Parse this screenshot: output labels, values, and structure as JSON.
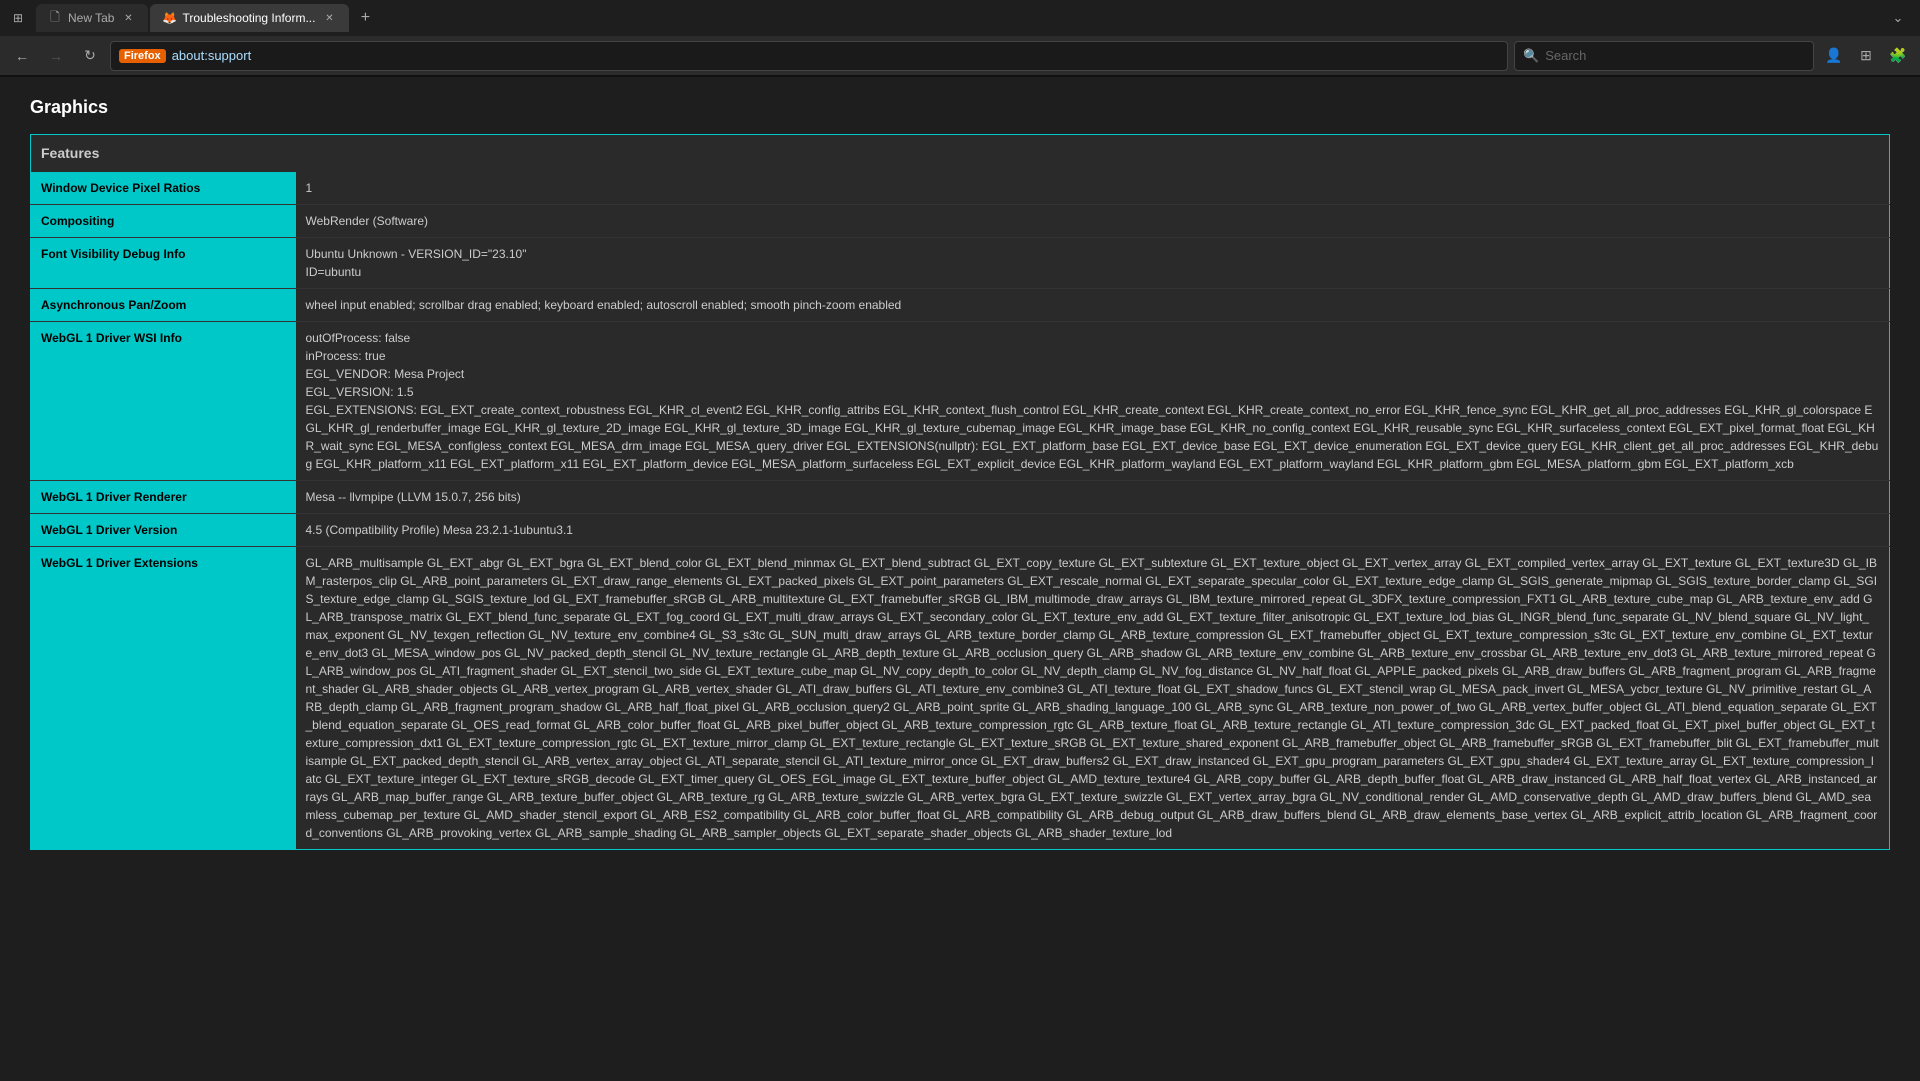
{
  "browser": {
    "window_icon": "⊞",
    "tabs": [
      {
        "id": "new-tab",
        "label": "New Tab",
        "active": false,
        "icon": "tab"
      },
      {
        "id": "troubleshooting",
        "label": "Troubleshooting Inform...",
        "active": true,
        "icon": "firefox"
      }
    ],
    "new_tab_label": "+",
    "tab_overflow_label": "⌄",
    "nav": {
      "back_disabled": false,
      "forward_disabled": true,
      "reload": "↻",
      "address": "about:support",
      "firefox_label": "Firefox",
      "search_placeholder": "Search"
    }
  },
  "page": {
    "section_title": "Graphics",
    "table": {
      "header": "Features",
      "rows": [
        {
          "key": "Window Device Pixel Ratios",
          "value": "1"
        },
        {
          "key": "Compositing",
          "value": "WebRender (Software)"
        },
        {
          "key": "Font Visibility Debug Info",
          "value": "Ubuntu Unknown - VERSION_ID=\"23.10\"\nID=ubuntu"
        },
        {
          "key": "Asynchronous Pan/Zoom",
          "value": "wheel input enabled; scrollbar drag enabled; keyboard enabled; autoscroll enabled; smooth pinch-zoom enabled"
        },
        {
          "key": "WebGL 1 Driver WSI Info",
          "value": "outOfProcess: false\ninProcess: true\nEGL_VENDOR: Mesa Project\nEGL_VERSION: 1.5\nEGL_EXTENSIONS: EGL_EXT_create_context_robustness EGL_KHR_cl_event2 EGL_KHR_config_attribs EGL_KHR_context_flush_control EGL_KHR_create_context EGL_KHR_create_context_no_error EGL_KHR_fence_sync EGL_KHR_get_all_proc_addresses EGL_KHR_gl_colorspace EGL_KHR_gl_renderbuffer_image EGL_KHR_gl_texture_2D_image EGL_KHR_gl_texture_3D_image EGL_KHR_gl_texture_cubemap_image EGL_KHR_image_base EGL_KHR_no_config_context EGL_KHR_reusable_sync EGL_KHR_surfaceless_context EGL_EXT_pixel_format_float EGL_KHR_wait_sync EGL_MESA_configless_context EGL_MESA_drm_image EGL_MESA_query_driver EGL_EXTENSIONS(nullptr): EGL_EXT_platform_base EGL_EXT_device_base EGL_EXT_device_enumeration EGL_EXT_device_query EGL_KHR_client_get_all_proc_addresses EGL_KHR_debug EGL_KHR_platform_x11 EGL_EXT_platform_x11 EGL_EXT_platform_device EGL_MESA_platform_surfaceless EGL_EXT_explicit_device EGL_KHR_platform_wayland EGL_EXT_platform_wayland EGL_KHR_platform_gbm EGL_MESA_platform_gbm EGL_EXT_platform_xcb"
        },
        {
          "key": "WebGL 1 Driver Renderer",
          "value": "Mesa -- llvmpipe (LLVM 15.0.7, 256 bits)"
        },
        {
          "key": "WebGL 1 Driver Version",
          "value": "4.5 (Compatibility Profile) Mesa 23.2.1-1ubuntu3.1"
        },
        {
          "key": "WebGL 1 Driver Extensions",
          "value": "GL_ARB_multisample GL_EXT_abgr GL_EXT_bgra GL_EXT_blend_color GL_EXT_blend_minmax GL_EXT_blend_subtract GL_EXT_copy_texture GL_EXT_subtexture GL_EXT_texture_object GL_EXT_vertex_array GL_EXT_compiled_vertex_array GL_EXT_texture GL_EXT_texture3D GL_IBM_rasterpos_clip GL_ARB_point_parameters GL_EXT_draw_range_elements GL_EXT_packed_pixels GL_EXT_point_parameters GL_EXT_rescale_normal GL_EXT_separate_specular_color GL_EXT_texture_edge_clamp GL_SGIS_generate_mipmap GL_SGIS_texture_border_clamp GL_SGIS_texture_edge_clamp GL_SGIS_texture_lod GL_EXT_framebuffer_sRGB GL_ARB_multitexture GL_EXT_framebuffer_sRGB GL_IBM_multimode_draw_arrays GL_IBM_texture_mirrored_repeat GL_3DFX_texture_compression_FXT1 GL_ARB_texture_cube_map GL_ARB_texture_env_add GL_ARB_transpose_matrix GL_EXT_blend_func_separate GL_EXT_fog_coord GL_EXT_multi_draw_arrays GL_EXT_secondary_color GL_EXT_texture_env_add GL_EXT_texture_filter_anisotropic GL_EXT_texture_lod_bias GL_INGR_blend_func_separate GL_NV_blend_square GL_NV_light_max_exponent GL_NV_texgen_reflection GL_NV_texture_env_combine4 GL_S3_s3tc GL_SUN_multi_draw_arrays GL_ARB_texture_border_clamp GL_ARB_texture_compression GL_EXT_framebuffer_object GL_EXT_texture_compression_s3tc GL_EXT_texture_env_combine GL_EXT_texture_env_dot3 GL_MESA_window_pos GL_NV_packed_depth_stencil GL_NV_texture_rectangle GL_ARB_depth_texture GL_ARB_occlusion_query GL_ARB_shadow GL_ARB_texture_env_combine GL_ARB_texture_env_crossbar GL_ARB_texture_env_dot3 GL_ARB_texture_mirrored_repeat GL_ARB_window_pos GL_ATI_fragment_shader GL_EXT_stencil_two_side GL_EXT_texture_cube_map GL_NV_copy_depth_to_color GL_NV_depth_clamp GL_NV_fog_distance GL_NV_half_float GL_APPLE_packed_pixels GL_ARB_draw_buffers GL_ARB_fragment_program GL_ARB_fragment_shader GL_ARB_shader_objects GL_ARB_vertex_program GL_ARB_vertex_shader GL_ATI_draw_buffers GL_ATI_texture_env_combine3 GL_ATI_texture_float GL_EXT_shadow_funcs GL_EXT_stencil_wrap GL_MESA_pack_invert GL_MESA_ycbcr_texture GL_NV_primitive_restart GL_ARB_depth_clamp GL_ARB_fragment_program_shadow GL_ARB_half_float_pixel GL_ARB_occlusion_query2 GL_ARB_point_sprite GL_ARB_shading_language_100 GL_ARB_sync GL_ARB_texture_non_power_of_two GL_ARB_vertex_buffer_object GL_ATI_blend_equation_separate GL_EXT_blend_equation_separate GL_OES_read_format GL_ARB_color_buffer_float GL_ARB_pixel_buffer_object GL_ARB_texture_compression_rgtc GL_ARB_texture_float GL_ARB_texture_rectangle GL_ATI_texture_compression_3dc GL_EXT_packed_float GL_EXT_pixel_buffer_object GL_EXT_texture_compression_dxt1 GL_EXT_texture_compression_rgtc GL_EXT_texture_mirror_clamp GL_EXT_texture_rectangle GL_EXT_texture_sRGB GL_EXT_texture_shared_exponent GL_ARB_framebuffer_object GL_ARB_framebuffer_sRGB GL_EXT_framebuffer_blit GL_EXT_framebuffer_multisample GL_EXT_packed_depth_stencil GL_ARB_vertex_array_object GL_ATI_separate_stencil GL_ATI_texture_mirror_once GL_EXT_draw_buffers2 GL_EXT_draw_instanced GL_EXT_gpu_program_parameters GL_EXT_gpu_shader4 GL_EXT_texture_array GL_EXT_texture_compression_latc GL_EXT_texture_integer GL_EXT_texture_sRGB_decode GL_EXT_timer_query GL_OES_EGL_image GL_EXT_texture_buffer_object GL_AMD_texture_texture4 GL_ARB_copy_buffer GL_ARB_depth_buffer_float GL_ARB_draw_instanced GL_ARB_half_float_vertex GL_ARB_instanced_arrays GL_ARB_map_buffer_range GL_ARB_texture_buffer_object GL_ARB_texture_rg GL_ARB_texture_swizzle GL_ARB_vertex_bgra GL_EXT_texture_swizzle GL_EXT_vertex_array_bgra GL_NV_conditional_render GL_AMD_conservative_depth GL_AMD_draw_buffers_blend GL_AMD_seamless_cubemap_per_texture GL_AMD_shader_stencil_export GL_ARB_ES2_compatibility GL_ARB_color_buffer_float GL_ARB_compatibility GL_ARB_debug_output GL_ARB_draw_buffers_blend GL_ARB_draw_elements_base_vertex GL_ARB_explicit_attrib_location GL_ARB_fragment_coord_conventions GL_ARB_provoking_vertex GL_ARB_sample_shading GL_ARB_sampler_objects GL_EXT_separate_shader_objects GL_ARB_shader_texture_lod"
        }
      ]
    }
  }
}
